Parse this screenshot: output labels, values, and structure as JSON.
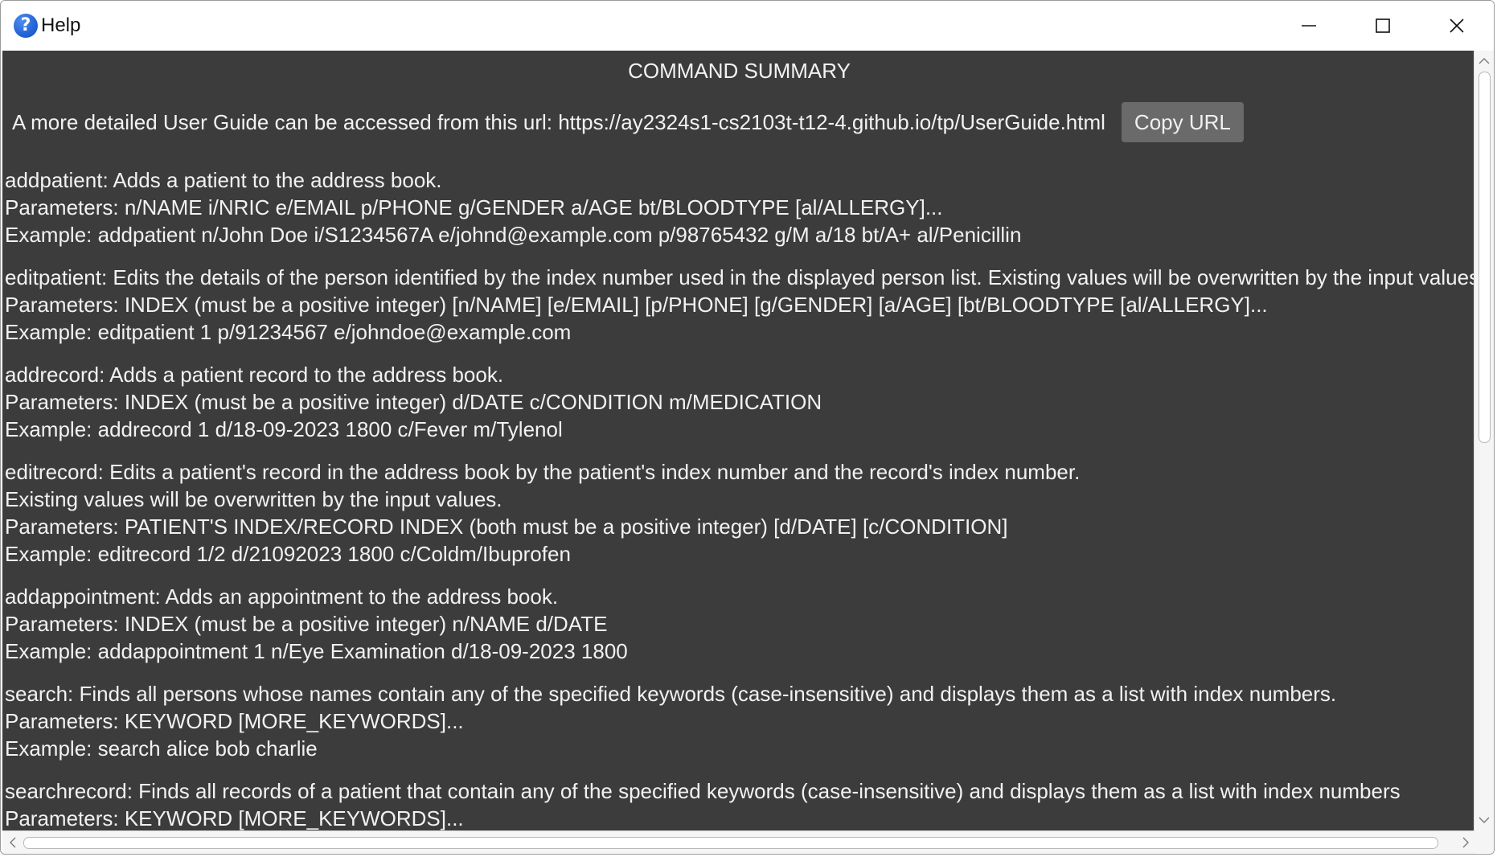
{
  "window": {
    "title": "Help",
    "icon": "question-icon",
    "controls": [
      "minimize-icon",
      "maximize-icon",
      "close-icon"
    ]
  },
  "summary": {
    "heading": "COMMAND SUMMARY",
    "url_text": "A more detailed User Guide can be accessed from this url: https://ay2324s1-cs2103t-t12-4.github.io/tp/UserGuide.html",
    "copy_button_label": "Copy URL"
  },
  "commands": [
    {
      "lines": [
        "addpatient: Adds a patient to the address book.",
        "Parameters: n/NAME i/NRIC e/EMAIL p/PHONE g/GENDER a/AGE bt/BLOODTYPE [al/ALLERGY]...",
        "Example: addpatient n/John Doe i/S1234567A e/johnd@example.com p/98765432 g/M a/18 bt/A+ al/Penicillin"
      ]
    },
    {
      "lines": [
        "editpatient: Edits the details of the person identified by the index number used in the displayed person list. Existing values will be overwritten by the input values.",
        "Parameters: INDEX (must be a positive integer) [n/NAME] [e/EMAIL] [p/PHONE] [g/GENDER] [a/AGE] [bt/BLOODTYPE [al/ALLERGY]...",
        "Example: editpatient 1 p/91234567 e/johndoe@example.com"
      ]
    },
    {
      "lines": [
        "addrecord: Adds a patient record to the address book.",
        "Parameters: INDEX (must be a positive integer) d/DATE c/CONDITION m/MEDICATION",
        "Example: addrecord 1 d/18-09-2023 1800 c/Fever m/Tylenol"
      ]
    },
    {
      "lines": [
        "editrecord: Edits a patient's record in the address book by the patient's index number and the record's index number.",
        "Existing values will be overwritten by the input values.",
        "Parameters: PATIENT'S INDEX/RECORD INDEX (both must be a positive integer) [d/DATE] [c/CONDITION]",
        "Example: editrecord 1/2 d/21092023 1800 c/Coldm/Ibuprofen"
      ]
    },
    {
      "lines": [
        "addappointment: Adds an appointment to the address book.",
        "Parameters: INDEX (must be a positive integer) n/NAME d/DATE",
        "Example: addappointment 1 n/Eye Examination d/18-09-2023 1800"
      ]
    },
    {
      "lines": [
        "search: Finds all persons whose names contain any of the specified keywords (case-insensitive) and displays them as a list with index numbers.",
        "Parameters: KEYWORD [MORE_KEYWORDS]...",
        "Example: search alice bob charlie"
      ]
    },
    {
      "lines": [
        "searchrecord: Finds all records of a patient that contain any of the specified keywords (case-insensitive) and displays them as a list with index numbers",
        "Parameters: KEYWORD [MORE_KEYWORDS]..."
      ]
    }
  ],
  "colors": {
    "content_bg": "#3c3c3c",
    "text": "#f2f2f2",
    "button_bg": "#6a6a6a",
    "app_icon": "#2463d6"
  }
}
